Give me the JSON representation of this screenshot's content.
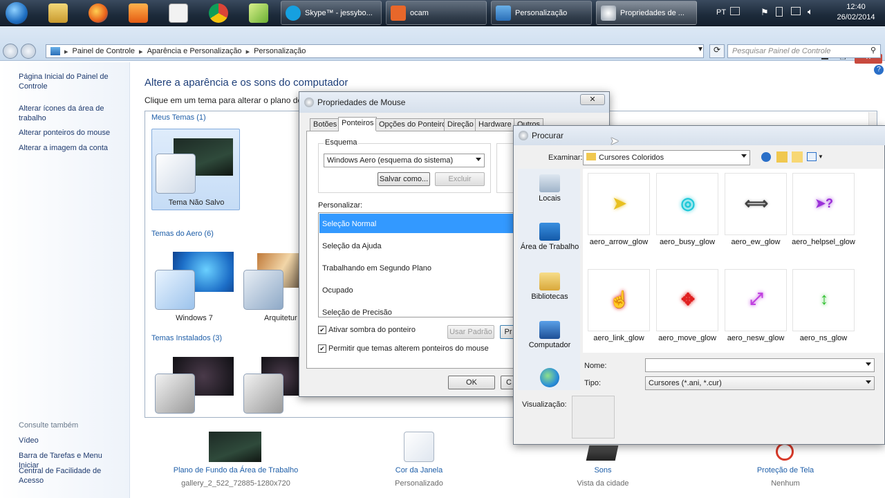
{
  "taskbar": {
    "buttons": [
      {
        "label": "Skype™ - jessybo..."
      },
      {
        "label": "ocam"
      },
      {
        "label": "Personalização"
      },
      {
        "label": "Propriedades de ..."
      }
    ],
    "tray": {
      "lang": "PT",
      "time": "12:40",
      "date": "26/02/2014"
    }
  },
  "address": {
    "crumbs": [
      "Painel de Controle",
      "Aparência e Personalização",
      "Personalização"
    ],
    "search_placeholder": "Pesquisar Painel de Controle"
  },
  "sidebar": {
    "links": [
      "Página Inicial do Painel de Controle",
      "Alterar ícones da área de trabalho",
      "Alterar ponteiros do mouse",
      "Alterar a imagem da conta"
    ],
    "see_also_title": "Consulte também",
    "see_also": [
      "Vídeo",
      "Barra de Tarefas e Menu Iniciar",
      "Central de Facilidade de Acesso"
    ]
  },
  "main": {
    "title": "Altere a aparência e os sons do computador",
    "subtitle": "Clique em um tema para alterar o plano de fu",
    "groups": {
      "my_themes": "Meus Temas (1)",
      "aero_themes": "Temas do Aero (6)",
      "installed_themes": "Temas Instalados (3)"
    },
    "themes": {
      "unsaved": "Tema Não Salvo",
      "win7": "Windows 7",
      "arch": "Arquitetur"
    },
    "bottom": [
      {
        "title": "Plano de Fundo da Área de Trabalho",
        "sub": "gallery_2_522_72885-1280x720"
      },
      {
        "title": "Cor da Janela",
        "sub": "Personalizado"
      },
      {
        "title": "Sons",
        "sub": "Vista da cidade"
      },
      {
        "title": "Proteção de Tela",
        "sub": "Nenhum"
      }
    ]
  },
  "mouse_dialog": {
    "title": "Propriedades de Mouse",
    "tabs": [
      "Botões",
      "Ponteiros",
      "Opções do Ponteiro",
      "Direção",
      "Hardware",
      "Outros"
    ],
    "scheme_label": "Esquema",
    "scheme_value": "Windows Aero (esquema do sistema)",
    "save_as": "Salvar como...",
    "delete": "Excluir",
    "customize_label": "Personalizar:",
    "list": [
      "Seleção Normal",
      "Seleção da Ajuda",
      "Trabalhando em Segundo Plano",
      "Ocupado",
      "Seleção de Precisão"
    ],
    "shadow_label": "Ativar sombra do ponteiro",
    "default_btn": "Usar Padrão",
    "browse_btn_partial": "Pr",
    "themes_allow_label": "Permitir que temas alterem ponteiros do mouse",
    "ok": "OK",
    "cancel_partial": "C"
  },
  "browse_dialog": {
    "title": "Procurar",
    "look_in_label": "Examinar:",
    "look_in_value": "Cursores Coloridos",
    "places": [
      "Locais",
      "Área de Trabalho",
      "Bibliotecas",
      "Computador"
    ],
    "cursors": [
      {
        "name": "aero_arrow_glow",
        "glyph": "➤",
        "color": "#e8c020"
      },
      {
        "name": "aero_busy_glow",
        "glyph": "◎",
        "color": "#20c8d8"
      },
      {
        "name": "aero_ew_glow",
        "glyph": "⟺",
        "color": "#444444"
      },
      {
        "name": "aero_helpsel_glow",
        "glyph": "➤?",
        "color": "#9a30d8"
      },
      {
        "name": "aero_link_glow",
        "glyph": "☝",
        "color": "#e02020"
      },
      {
        "name": "aero_move_glow",
        "glyph": "✥",
        "color": "#e02020"
      },
      {
        "name": "aero_nesw_glow",
        "glyph": "⤢",
        "color": "#c040e0"
      },
      {
        "name": "aero_ns_glow",
        "glyph": "↕",
        "color": "#30c030"
      }
    ],
    "name_label": "Nome:",
    "name_value": "",
    "type_label": "Tipo:",
    "type_value": "Cursores (*.ani, *.cur)",
    "preview_label": "Visualização:"
  }
}
